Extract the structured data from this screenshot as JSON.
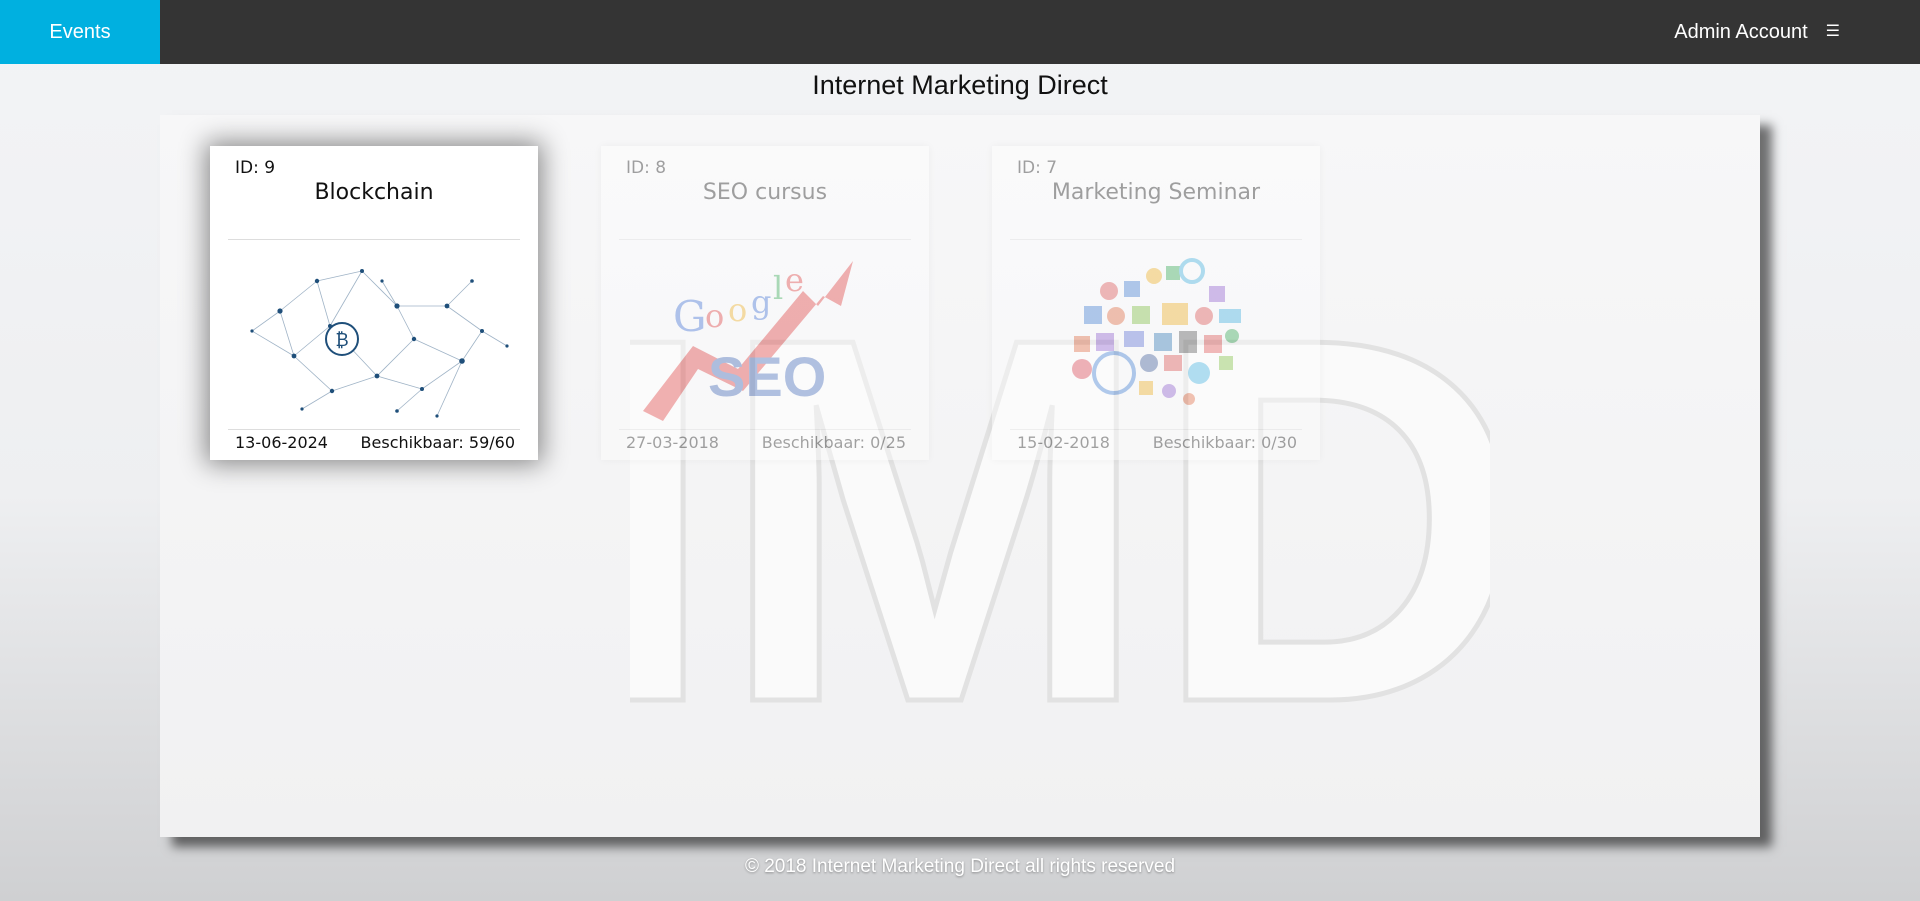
{
  "nav": {
    "events_label": "Events",
    "account_label": "Admin Account",
    "menu_icon": "menu-icon"
  },
  "page": {
    "title": "Internet Marketing Direct"
  },
  "watermark": {
    "text": "IMD"
  },
  "events": [
    {
      "id_label": "ID: 9",
      "title": "Blockchain",
      "date": "13-06-2024",
      "availability": "Beschikbaar: 59/60",
      "image": "blockchain-network-image"
    },
    {
      "id_label": "ID: 8",
      "title": "SEO cursus",
      "date": "27-03-2018",
      "availability": "Beschikbaar: 0/25",
      "image": "google-seo-image"
    },
    {
      "id_label": "ID: 7",
      "title": "Marketing Seminar",
      "date": "15-02-2018",
      "availability": "Beschikbaar: 0/30",
      "image": "social-media-icons-image"
    }
  ],
  "footer": {
    "text": "© 2018 Internet Marketing Direct all rights reserved"
  },
  "colors": {
    "topbar": "#343434",
    "accent": "#00b0e0",
    "network": "#1f4f7a"
  }
}
